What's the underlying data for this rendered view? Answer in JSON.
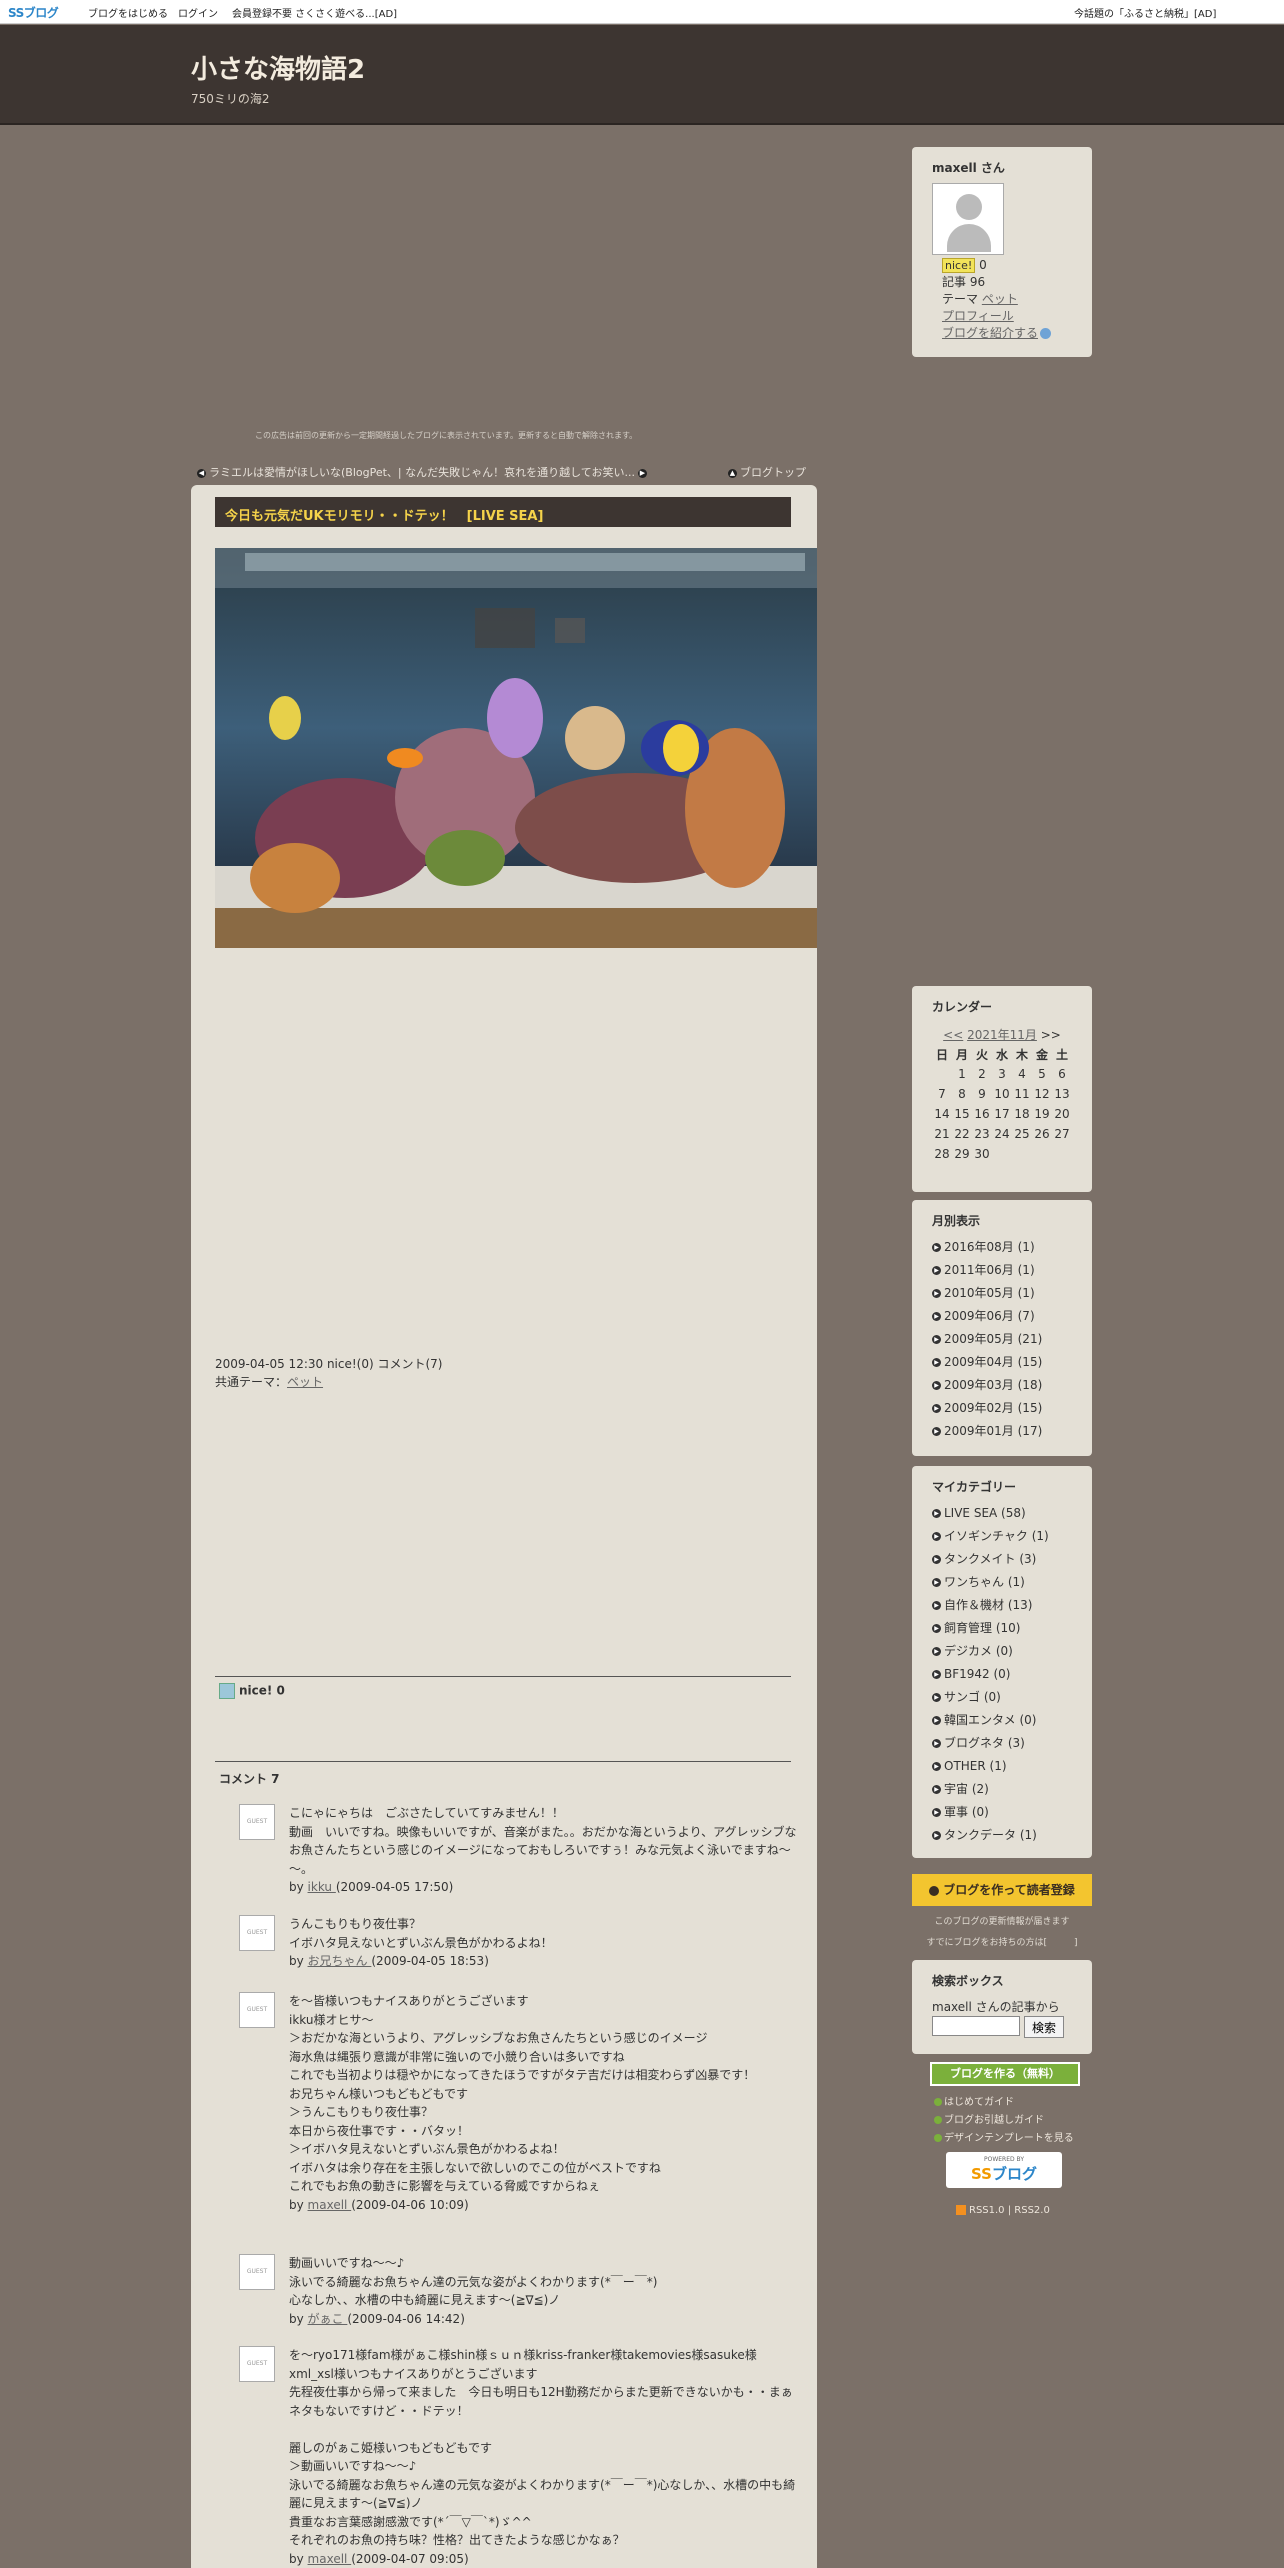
{
  "topbar": {
    "logo_a": "SS",
    "logo_b": "ブログ",
    "start": "ブログをはじめる",
    "login": "ログイン",
    "ad1": "会員登録不要 さくさく遊べる...[AD]",
    "ad2": "今話題の「ふるさと納税」[AD]"
  },
  "header": {
    "title": "小さな海物語2",
    "description": "750ミリの海2"
  },
  "ad_note": "この広告は前回の更新から一定期間経過したブログに表示されています。更新すると自動で解除されます。",
  "nav": {
    "prev": "ラミエルは愛情がほしいな(BlogPet、| なんだ失敗じゃん！哀れを通り越してお笑い...",
    "top": "ブログトップ"
  },
  "post": {
    "title": "今日も元気だUKモリモリ・・ドテッ！　[LIVE SEA]",
    "meta": "2009-04-05 12:30  nice!(0)  コメント(7)",
    "theme_label": "共通テーマ：",
    "theme": "ペット",
    "nice": "nice! 0",
    "comments_title": "コメント 7"
  },
  "comments": [
    {
      "text": "こにゃにゃちは　ごぶさたしていてすみません！！\n動画　いいですね。映像もいいですが、音楽がまた。。おだかな海というより、アグレッシブなお魚さんたちという感じのイメージになっておもしろいですぅ！みな元気よく泳いでますね～～。",
      "by": "by ",
      "author": "ikku ",
      "date": "(2009-04-05 17:50)"
    },
    {
      "text": "うんこもりもり夜仕事？\nイボハタ見えないとずいぶん景色がかわるよね！",
      "by": "by ",
      "author": "お兄ちゃん ",
      "date": "(2009-04-05 18:53)"
    },
    {
      "text": "を～皆様いつもナイスありがとうございます\nikku様オヒサ～\n＞おだかな海というより、アグレッシブなお魚さんたちという感じのイメージ\n海水魚は縄張り意識が非常に強いので小競り合いは多いですね\nこれでも当初よりは穏やかになってきたほうですがタテ吉だけは相変わらず凶暴です！\nお兄ちゃん様いつもどもどもです\n＞うんこもりもり夜仕事？\n本日から夜仕事です・・バタッ！\n＞イボハタ見えないとずいぶん景色がかわるよね！\nイボハタは余り存在を主張しないで欲しいのでこの位がベストですね\nこれでもお魚の動きに影響を与えている脅威ですからねぇ",
      "by": "by ",
      "author": "maxell ",
      "date": "(2009-04-06 10:09)"
    },
    {
      "text": "動画いいですね～～♪\n泳いでる綺麗なお魚ちゃん達の元気な姿がよくわかります(*￣ー￣*)\n心なしか、、水槽の中も綺麗に見えます～(≧∇≦)ノ",
      "by": "by ",
      "author": "がぁこ ",
      "date": "(2009-04-06 14:42)"
    },
    {
      "text": "を～ryo171様fam様がぁこ様shin様ｓｕｎ様kriss-franker様takemovies様sasuke様xml_xsl様いつもナイスありがとうございます\n先程夜仕事から帰って来ました　今日も明日も12H勤務だからまた更新できないかも・・まぁネタもないですけど・・ドテッ！\n\n麗しのがぁこ姫様いつもどもどもです\n＞動画いいですね～～♪\n泳いでる綺麗なお魚ちゃん達の元気な姿がよくわかります(*￣ー￣*)心なしか、、水槽の中も綺麗に見えます～(≧∇≦)ノ\n貴重なお言葉感謝感激です(*´￣▽￣`*)ゞ^^\nそれぞれのお魚の持ち味？性格？出てきたような感じかなぁ？",
      "by": "by ",
      "author": "maxell ",
      "date": "(2009-04-07 09:05)"
    }
  ],
  "sidebar": {
    "profile": {
      "name": "maxell さん",
      "nice_label": "nice!",
      "nice_count": " 0",
      "articles": "記事 96",
      "theme_label": "テーマ ",
      "theme": "ペット",
      "profile_link": "プロフィール",
      "intro_link": "ブログを紹介する"
    },
    "calendar": {
      "title": "カレンダー",
      "prev": "<<",
      "month": "2021年11月",
      "next": ">>",
      "weekdays": [
        "日",
        "月",
        "火",
        "水",
        "木",
        "金",
        "土"
      ],
      "weeks": [
        [
          "",
          "1",
          "2",
          "3",
          "4",
          "5",
          "6"
        ],
        [
          "7",
          "8",
          "9",
          "10",
          "11",
          "12",
          "13"
        ],
        [
          "14",
          "15",
          "16",
          "17",
          "18",
          "19",
          "20"
        ],
        [
          "21",
          "22",
          "23",
          "24",
          "25",
          "26",
          "27"
        ],
        [
          "28",
          "29",
          "30",
          "",
          "",
          "",
          ""
        ]
      ]
    },
    "monthly": {
      "title": "月別表示",
      "items": [
        "2016年08月 (1)",
        "2011年06月 (1)",
        "2010年05月 (1)",
        "2009年06月 (7)",
        "2009年05月 (21)",
        "2009年04月 (15)",
        "2009年03月 (18)",
        "2009年02月 (15)",
        "2009年01月 (17)"
      ]
    },
    "category": {
      "title": "マイカテゴリー",
      "items": [
        "LIVE SEA (58)",
        "イソギンチャク (1)",
        "タンクメイト (3)",
        "ワンちゃん (1)",
        "自作＆機材 (13)",
        "飼育管理 (10)",
        "デジカメ (0)",
        "BF1942 (0)",
        "サンゴ (0)",
        "韓国エンタメ (0)",
        "ブログネタ (3)",
        "OTHER (1)",
        "宇宙 (2)",
        "軍事 (0)",
        "タンクデータ (1)"
      ]
    },
    "reader_button": "ブログを作って読者登録",
    "reader_note1": "このブログの更新情報が届きます",
    "reader_note2": "すでにブログをお持ちの方は[　　　]",
    "search": {
      "title": "検索ボックス",
      "label": "maxell さんの記事から",
      "button": "検索"
    },
    "make_blog": "ブログを作る（無料）",
    "guides": [
      "はじめてガイド",
      "ブログお引越しガイド",
      "デザインテンプレートを見る"
    ],
    "powered": "POWERED BY",
    "rss": "RSS1.0 | RSS2.0"
  }
}
